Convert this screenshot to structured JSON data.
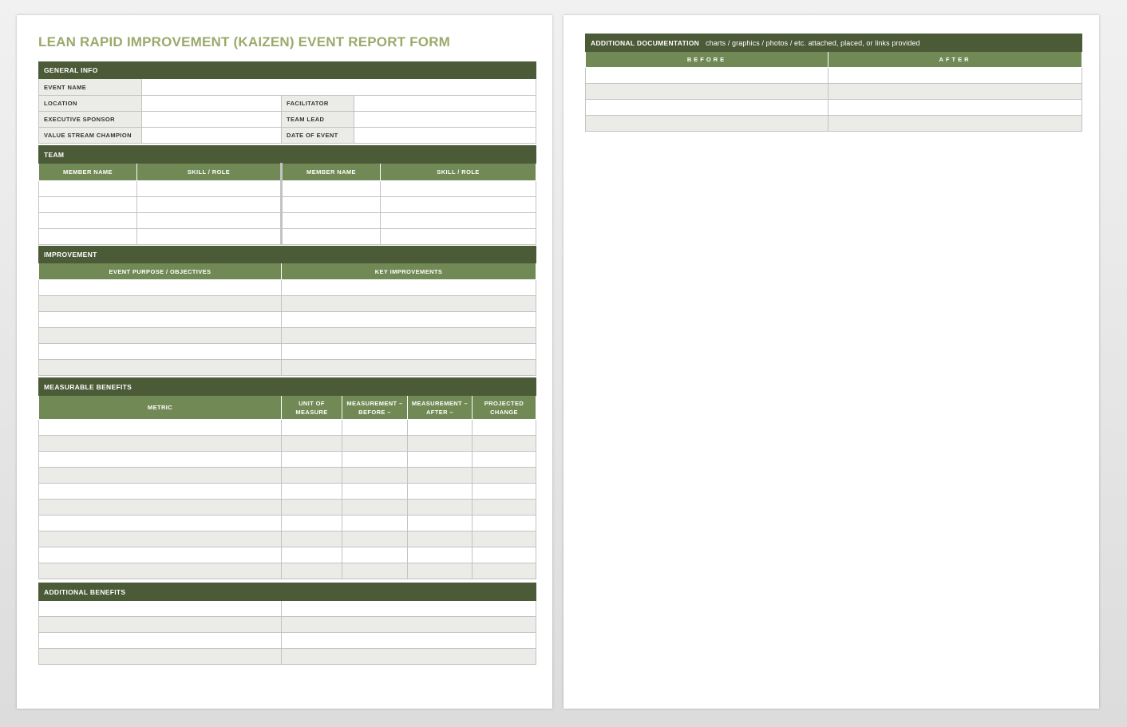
{
  "document": {
    "title": "LEAN RAPID IMPROVEMENT (KAIZEN) EVENT REPORT FORM"
  },
  "general_info": {
    "heading": "GENERAL INFO",
    "event_name_label": "EVENT NAME",
    "location_label": "LOCATION",
    "facilitator_label": "FACILITATOR",
    "executive_sponsor_label": "EXECUTIVE SPONSOR",
    "team_lead_label": "TEAM LEAD",
    "value_stream_champion_label": "VALUE STREAM CHAMPION",
    "date_of_event_label": "DATE OF EVENT"
  },
  "team": {
    "heading": "TEAM",
    "member_name_header": "MEMBER NAME",
    "skill_role_header": "SKILL / ROLE"
  },
  "improvement": {
    "heading": "IMPROVEMENT",
    "purpose_header": "EVENT PURPOSE / OBJECTIVES",
    "key_improvements_header": "KEY IMPROVEMENTS"
  },
  "measurable_benefits": {
    "heading": "MEASURABLE BENEFITS",
    "columns": [
      "METRIC",
      "UNIT OF MEASURE",
      "MEASUREMENT – BEFORE –",
      "MEASUREMENT – AFTER –",
      "PROJECTED CHANGE"
    ]
  },
  "additional_benefits": {
    "heading": "ADDITIONAL BENEFITS"
  },
  "additional_documentation": {
    "heading": "ADDITIONAL DOCUMENTATION",
    "subheading": "charts / graphics / photos / etc. attached, placed, or links provided",
    "before_header": "BEFORE",
    "after_header": "AFTER"
  },
  "colors": {
    "section_header": "#4b5a37",
    "column_header": "#718955",
    "title": "#9aaa6a",
    "alt_row": "#ebebe8"
  }
}
